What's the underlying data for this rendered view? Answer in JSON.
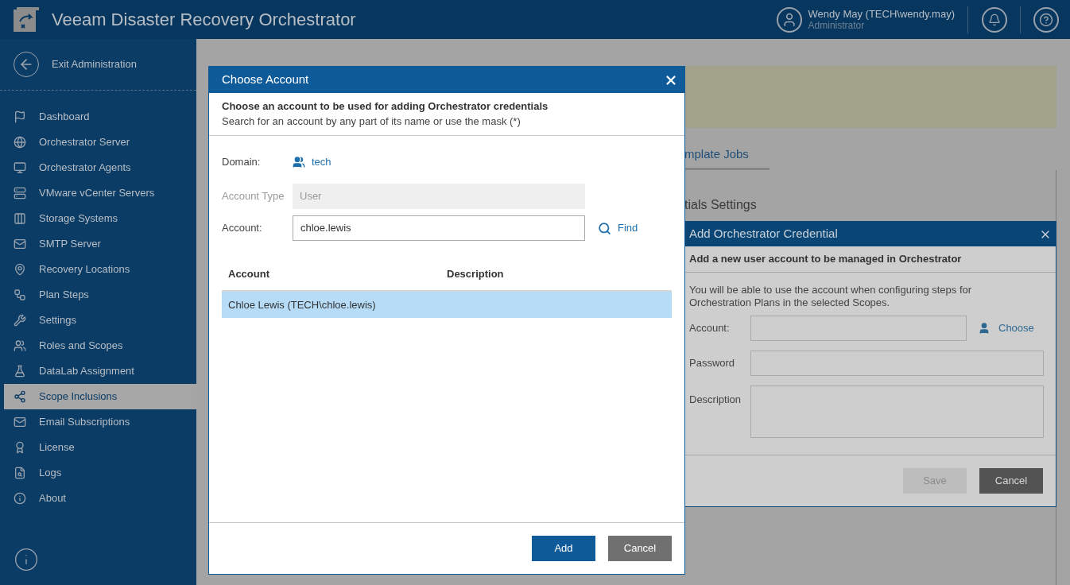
{
  "header": {
    "title": "Veeam Disaster Recovery Orchestrator",
    "user": {
      "name": "Wendy May (TECH\\wendy.may)",
      "role": "Administrator"
    }
  },
  "sidebar": {
    "exit_label": "Exit Administration",
    "items": [
      {
        "label": "Dashboard",
        "selected": false
      },
      {
        "label": "Orchestrator Server",
        "selected": false
      },
      {
        "label": "Orchestrator Agents",
        "selected": false
      },
      {
        "label": "VMware vCenter Servers",
        "selected": false
      },
      {
        "label": "Storage Systems",
        "selected": false
      },
      {
        "label": "SMTP Server",
        "selected": false
      },
      {
        "label": "Recovery Locations",
        "selected": false
      },
      {
        "label": "Plan Steps",
        "selected": false
      },
      {
        "label": "Settings",
        "selected": false
      },
      {
        "label": "Roles and Scopes",
        "selected": false
      },
      {
        "label": "DataLab Assignment",
        "selected": false
      },
      {
        "label": "Scope Inclusions",
        "selected": true
      },
      {
        "label": "Email Subscriptions",
        "selected": false
      },
      {
        "label": "License",
        "selected": false
      },
      {
        "label": "Logs",
        "selected": false
      },
      {
        "label": "About",
        "selected": false
      }
    ]
  },
  "background": {
    "tab_label": "mplate Jobs",
    "section_title": "tials Settings"
  },
  "choose_account": {
    "title": "Choose Account",
    "heading": "Choose an account to be used for adding Orchestrator credentials",
    "subheading": "Search for an account by any part of its name or use the mask (*)",
    "domain_label": "Domain:",
    "domain_value": "tech",
    "account_type": {
      "label": "Account Type",
      "value": "User",
      "disabled": true
    },
    "account": {
      "label": "Account:",
      "value": "chloe.lewis"
    },
    "find_label": "Find",
    "table": {
      "columns": [
        "Account",
        "Description"
      ],
      "rows": [
        {
          "cells": [
            "Chloe Lewis (TECH\\chloe.lewis)"
          ],
          "selected": true
        }
      ]
    },
    "buttons": [
      {
        "label": "Add",
        "kind": "primary"
      },
      {
        "label": "Cancel",
        "kind": "secondary"
      }
    ]
  },
  "credential_dialog": {
    "title": "Add Orchestrator Credential",
    "heading": "Add a new user account to be managed in Orchestrator",
    "body": "You will be able to use the account when configuring steps for Orchestration Plans in the selected Scopes.",
    "fields": [
      {
        "label": "Account:",
        "kind": "chooser"
      },
      {
        "label": "Password",
        "kind": "input"
      },
      {
        "label": "Description",
        "kind": "textarea"
      }
    ],
    "choose_label": "Choose",
    "buttons": [
      {
        "label": "Save",
        "disabled": true
      },
      {
        "label": "Cancel",
        "disabled": false
      }
    ]
  }
}
